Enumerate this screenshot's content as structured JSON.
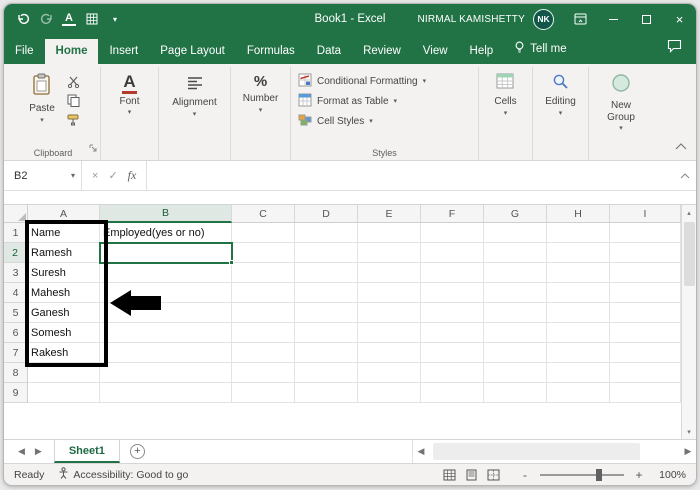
{
  "colors": {
    "accent": "#217346",
    "avatar_bg": "#12564a",
    "annotation": "#000000"
  },
  "symbols": {
    "caret": "▾",
    "up_caret": "▴",
    "left_arrow": "◀",
    "right_arrow": "▶"
  },
  "window": {
    "title": "Book1 - Excel",
    "user": "NIRMAL KAMISHETTY",
    "user_initials": "NK"
  },
  "tabs": {
    "items": [
      "File",
      "Home",
      "Insert",
      "Page Layout",
      "Formulas",
      "Data",
      "Review",
      "View",
      "Help"
    ],
    "active": "Home",
    "tell_me": "Tell me"
  },
  "ribbon": {
    "clipboard": {
      "paste_label": "Paste",
      "group_label": "Clipboard"
    },
    "font": {
      "icon_letter": "A",
      "group_label": "Font"
    },
    "alignment": {
      "group_label": "Alignment"
    },
    "number": {
      "icon": "%",
      "group_label": "Number"
    },
    "styles": {
      "items": [
        "Conditional Formatting",
        "Format as Table",
        "Cell Styles"
      ],
      "group_label": "Styles"
    },
    "cells": {
      "group_label": "Cells"
    },
    "editing": {
      "group_label": "Editing"
    },
    "new_group": {
      "group_label": "New Group"
    }
  },
  "formula_bar": {
    "name_box": "B2",
    "fx": "fx",
    "cancel": "×",
    "enter": "✓",
    "value": ""
  },
  "grid": {
    "columns": [
      "A",
      "B",
      "C",
      "D",
      "E",
      "F",
      "G",
      "H",
      "I"
    ],
    "rows": [
      "1",
      "2",
      "3",
      "4",
      "5",
      "6",
      "7",
      "8",
      "9"
    ],
    "active_col": "B",
    "active_row": "2",
    "selected_cell": "B2",
    "cells": {
      "A1": "Name",
      "A2": "Ramesh",
      "A3": "Suresh",
      "A4": "Mahesh",
      "A5": "Ganesh",
      "A6": "Somesh",
      "A7": "Rakesh",
      "B1": "Employed(yes or no)"
    }
  },
  "sheet_bar": {
    "active_sheet": "Sheet1"
  },
  "status_bar": {
    "mode": "Ready",
    "accessibility": "Accessibility: Good to go",
    "zoom": "100%"
  }
}
